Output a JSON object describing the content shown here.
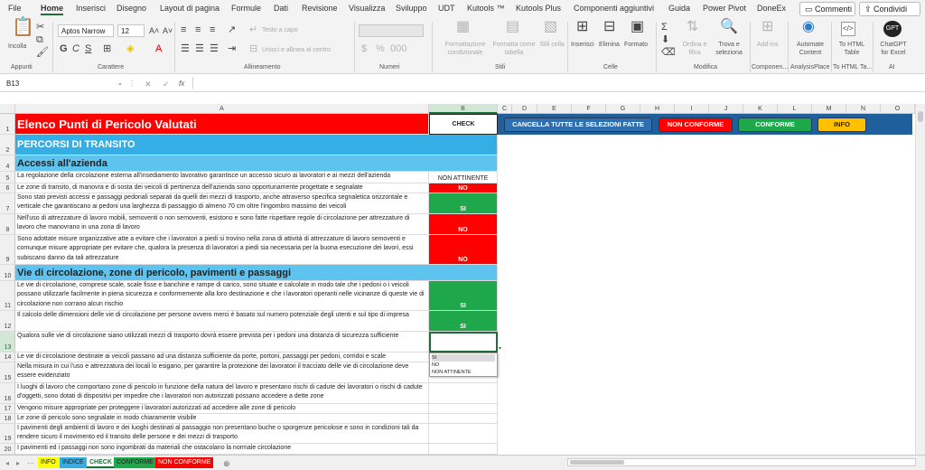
{
  "menu": {
    "items": [
      "File",
      "Home",
      "Inserisci",
      "Disegno",
      "Layout di pagina",
      "Formule",
      "Dati",
      "Revisione",
      "Visualizza",
      "Sviluppo",
      "UDT",
      "Kutools ™",
      "Kutools Plus",
      "Componenti aggiuntivi",
      "Guida",
      "Power Pivot",
      "DoneEx"
    ],
    "comments": "Commenti",
    "share": "Condividi"
  },
  "ribbon": {
    "paste": "Incolla",
    "font_name": "Aptos Narrow",
    "font_size": "12",
    "wrap_text": "Testo a capo",
    "merge": "Unisci e allinea al centro",
    "cond_format": "Formattazione condizionale",
    "format_table": "Formatta come tabella",
    "cell_styles": "Stili cella",
    "insert": "Inserisci",
    "delete": "Elimina",
    "format": "Formato",
    "sort_filter": "Ordina e filtra",
    "find_select": "Trova e seleziona",
    "addin": "Add-ins",
    "autocontent": "Automate Content",
    "to_html": "To HTML Table",
    "chatgpt": "ChatGPT for Excel",
    "groups": [
      "Appunti",
      "Carattere",
      "Allineamento",
      "Numeri",
      "Stili",
      "Celle",
      "Modifica",
      "Componen...",
      "AnalysisPlace",
      "To HTML Ta...",
      "AI"
    ]
  },
  "formula_bar": {
    "name_box": "B13",
    "fx": "fx",
    "value": ""
  },
  "columns": [
    "A",
    "B",
    "C",
    "D",
    "E",
    "F",
    "G",
    "H",
    "I",
    "J",
    "K",
    "L",
    "M",
    "N",
    "O"
  ],
  "buttons": {
    "clear": "CANCELLA TUTTE LE SELEZIONI FATTE",
    "non_conforme": "NON CONFORME",
    "conforme": "CONFORME",
    "info": "INFO"
  },
  "rows": [
    {
      "n": "1",
      "a": "Elenco Punti di Pericolo Valutati",
      "b": "CHECK"
    },
    {
      "n": "2",
      "a": "PERCORSI DI TRANSITO",
      "b": ""
    },
    {
      "n": "4",
      "a": "Accessi all'azienda",
      "b": ""
    },
    {
      "n": "5",
      "a": "La regolazione della circolazione esterna all'insediamento lavorativo garantisce un accesso sicuro ai lavoratori e ai mezzi dell'azienda",
      "b": "NON ATTINENTE"
    },
    {
      "n": "6",
      "a": "Le zone di transito, di manovra e di sosta dei veicoli di pertinenza dell'azienda sono opportunamente progettate e segnalate",
      "b": "NO"
    },
    {
      "n": "7",
      "a": "Sono stati previsti accessi e passaggi pedonali separati da quelli dei mezzi di trasporto, anche attraverso specifica segnaletica orizzontale e verticale che garantiscano ai pedoni una larghezza di passaggio di almeno 70 cm oltre l'ingombro massimo dei veicoli",
      "b": "SI"
    },
    {
      "n": "8",
      "a": "Nell'uso di attrezzature di lavoro mobili, semoventi o non semoventi, esistono e sono fatte rispettare regole di circolazione per attrezzature di lavoro che manovrano in una zona di lavoro",
      "b": "NO"
    },
    {
      "n": "9",
      "a": "Sono adottate misure organizzative atte a evitare che i lavoratori a piedi si trovino nella zona di attività di attrezzature di lavoro semoventi e comunque misure appropriate per evitare che, qualora la presenza di lavoratori a piedi sia necessaria per la buona esecuzione dei lavori, essi subiscano danno da tali attrezzature",
      "b": "NO"
    },
    {
      "n": "10",
      "a": "Vie di circolazione, zone di pericolo, pavimenti e passaggi",
      "b": ""
    },
    {
      "n": "11",
      "a": "Le vie di circolazione, comprese scale, scale fisse e banchine e rampe di carico, sono situate e calcolate in modo tale che i pedoni o i veicoli possano utilizzarle facilmente in piena sicurezza e conformemente alla loro destinazione e che i lavoratori operanti nelle vicinanze di queste vie di circolazione non corrano alcun rischio",
      "b": "SI"
    },
    {
      "n": "12",
      "a": "Il calcolo delle dimensioni delle vie di circolazione per persone ovvero merci è basato sul numero potenziale degli utenti e sul tipo di impresa",
      "b": "SI"
    },
    {
      "n": "13",
      "a": "Qualora sulle vie di circolazione siano utilizzati mezzi di trasporto dovrà essere prevista per i pedoni una distanza di sicurezza sufficiente",
      "b": ""
    },
    {
      "n": "14",
      "a": "Le vie di circolazione destinate ai veicoli passano ad una distanza sufficiente da porte, portoni, passaggi per pedoni, corridoi e scale",
      "b": ""
    },
    {
      "n": "15",
      "a": "Nella misura in cui l'uso e attrezzatura dei locali lo esigano, per garantire la protezione dei lavoratori il tracciato delle vie di circolazione deve essere evidenziato",
      "b": ""
    },
    {
      "n": "16",
      "a": "I luoghi di lavoro che comportano zone di pericolo in funzione della natura del lavoro e presentano rischi di cadute dei lavoratori o rischi di cadute d'oggetti, sono dotati di dispositivi per impedire che i lavoratori non autorizzati possano accedere a dette zone",
      "b": ""
    },
    {
      "n": "17",
      "a": "Vengono misure appropriate per proteggere i lavoratori autorizzati ad accedere alle zone di pericolo",
      "b": ""
    },
    {
      "n": "18",
      "a": "Le zone di pericolo sono segnalate in modo chiaramente visibile",
      "b": ""
    },
    {
      "n": "19",
      "a": "I pavimenti degli ambienti di lavoro e dei luoghi destinati al passaggio non presentano buche o sporgenze pericolose e sono in condizioni tali da rendere sicuro il movimento ed il transito delle persone e dei mezzi di trasporto",
      "b": ""
    },
    {
      "n": "20",
      "a": "I pavimenti ed i passaggi non sono ingombrati da materiali che ostacolano la normale circolazione",
      "b": ""
    }
  ],
  "dropdown_options": [
    "SI",
    "NO",
    "NON ATTINENTE"
  ],
  "sheet_tabs": [
    "INFO",
    "INDICE",
    "CHECK",
    "CONFORME",
    "NON CONFORME"
  ],
  "colors": {
    "red": "#ff0000",
    "green": "#1ea84b",
    "header_blue": "#35aee6",
    "sub_blue": "#bfe6f6",
    "btn_blue": "#1f5f9c",
    "yellow": "#ffc000"
  }
}
